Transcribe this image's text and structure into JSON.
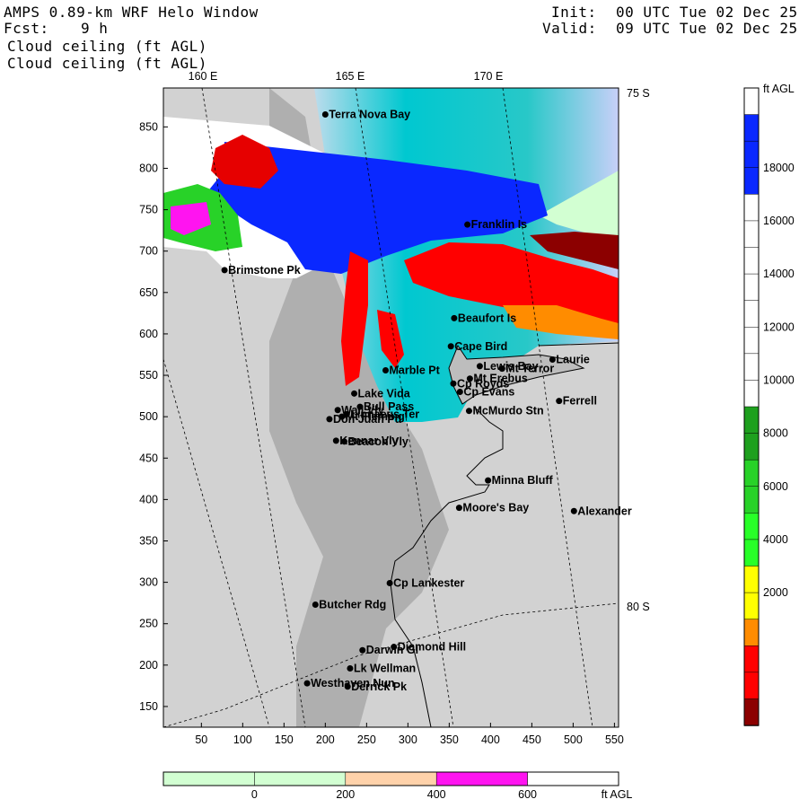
{
  "header": {
    "title": "AMPS 0.89-km WRF Helo Window",
    "fcst_label": "Fcst:",
    "fcst_value": "9 h",
    "field_1": "Cloud ceiling (ft AGL)",
    "field_2": "Cloud ceiling (ft AGL)",
    "init_label": "Init:",
    "init_value": "00 UTC Tue 02 Dec 25",
    "valid_label": "Valid:",
    "valid_value": "09 UTC Tue 02 Dec 25"
  },
  "map": {
    "lon_labels": [
      "160 E",
      "165 E",
      "170 E"
    ],
    "lat_labels": [
      "75 S",
      "80 S"
    ],
    "x_ticks": [
      "50",
      "100",
      "150",
      "200",
      "250",
      "300",
      "350",
      "400",
      "450",
      "500",
      "550"
    ],
    "y_ticks": [
      "850",
      "800",
      "750",
      "700",
      "650",
      "600",
      "550",
      "500",
      "450",
      "400",
      "350",
      "300",
      "250",
      "200",
      "150"
    ],
    "stations": [
      {
        "name": "Terra Nova Bay",
        "x": 200,
        "y": 865
      },
      {
        "name": "Franklin Is",
        "x": 372,
        "y": 732
      },
      {
        "name": "Brimstone Pk",
        "x": 78,
        "y": 677
      },
      {
        "name": "Beaufort Is",
        "x": 356,
        "y": 619
      },
      {
        "name": "Cape Bird",
        "x": 352,
        "y": 585
      },
      {
        "name": "Laurie",
        "x": 475,
        "y": 569
      },
      {
        "name": "Lewis Bay",
        "x": 387,
        "y": 561
      },
      {
        "name": "Mt Terror",
        "x": 414,
        "y": 558
      },
      {
        "name": "Marble Pt",
        "x": 273,
        "y": 556
      },
      {
        "name": "Mt Erebus",
        "x": 375,
        "y": 546
      },
      {
        "name": "Cp Royds",
        "x": 355,
        "y": 540
      },
      {
        "name": "Cp Evans",
        "x": 363,
        "y": 530
      },
      {
        "name": "Lake Vida",
        "x": 235,
        "y": 528
      },
      {
        "name": "Ferrell",
        "x": 483,
        "y": 519
      },
      {
        "name": "Wall Vly",
        "x": 215,
        "y": 508
      },
      {
        "name": "Bull Pass",
        "x": 242,
        "y": 512
      },
      {
        "name": "McMurdo Stn",
        "x": 374,
        "y": 507
      },
      {
        "name": "Don Juan Pd",
        "x": 205,
        "y": 497
      },
      {
        "name": "Mt Fleming",
        "x": 220,
        "y": 500
      },
      {
        "name": "Linnaeus Ter",
        "x": 226,
        "y": 503
      },
      {
        "name": "Kennar Vly",
        "x": 213,
        "y": 471
      },
      {
        "name": "Beacon Vly",
        "x": 223,
        "y": 470
      },
      {
        "name": "Minna Bluff",
        "x": 397,
        "y": 423
      },
      {
        "name": "Moore's Bay",
        "x": 362,
        "y": 390
      },
      {
        "name": "Alexander",
        "x": 501,
        "y": 386
      },
      {
        "name": "Cp Lankester",
        "x": 278,
        "y": 299
      },
      {
        "name": "Butcher Rdg",
        "x": 188,
        "y": 273
      },
      {
        "name": "Diamond Hill",
        "x": 283,
        "y": 222
      },
      {
        "name": "Darwin Gl",
        "x": 245,
        "y": 218
      },
      {
        "name": "Lk Wellman",
        "x": 230,
        "y": 196
      },
      {
        "name": "Westhaven Nun",
        "x": 178,
        "y": 178
      },
      {
        "name": "Derrick Pk",
        "x": 227,
        "y": 174
      }
    ]
  },
  "right_colorbar": {
    "unit": "ft AGL",
    "labels": [
      "18000",
      "16000",
      "14000",
      "12000",
      "10000",
      "8000",
      "6000",
      "4000",
      "2000"
    ],
    "colors": [
      "#ffffff",
      "#0a28ff",
      "#0a28ff",
      "#0a28ff",
      "#ffffff",
      "#ffffff",
      "#ffffff",
      "#ffffff",
      "#ffffff",
      "#ffffff",
      "#ffffff",
      "#ffffff",
      "#1ea01e",
      "#1ea01e",
      "#28d228",
      "#28d228",
      "#28ff28",
      "#28ff28",
      "#ffff00",
      "#ffff00",
      "#ff8c00",
      "#ff0000",
      "#ff0000",
      "#8c0000"
    ]
  },
  "bottom_colorbar": {
    "unit": "ft AGL",
    "labels": [
      "0",
      "200",
      "400",
      "600"
    ],
    "colors": [
      "#d2ffd2",
      "#d2ffd2",
      "#ffd2aa",
      "#ff14f0",
      "#ffffff"
    ]
  }
}
